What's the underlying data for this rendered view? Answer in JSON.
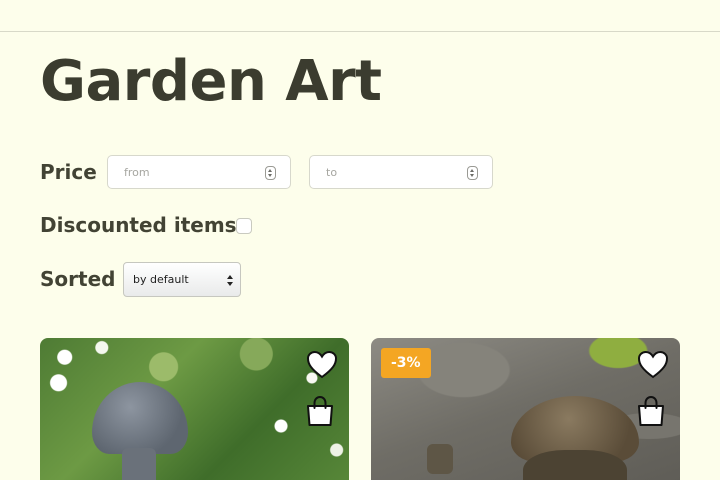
{
  "page": {
    "title": "Garden Art"
  },
  "filters": {
    "price_label": "Price",
    "price_from_placeholder": "from",
    "price_to_placeholder": "to",
    "discounted_label": "Discounted items",
    "discounted_checked": false,
    "sort_label": "Sorted",
    "sort_value": "by default"
  },
  "products": [
    {
      "discount": "",
      "icons": [
        "heart-icon",
        "shopping-bag-icon"
      ]
    },
    {
      "discount": "-3%",
      "icons": [
        "heart-icon",
        "shopping-bag-icon"
      ]
    }
  ],
  "colors": {
    "background": "#fdfeeb",
    "text": "#3c3d2f",
    "discount_badge": "#f4a623"
  }
}
